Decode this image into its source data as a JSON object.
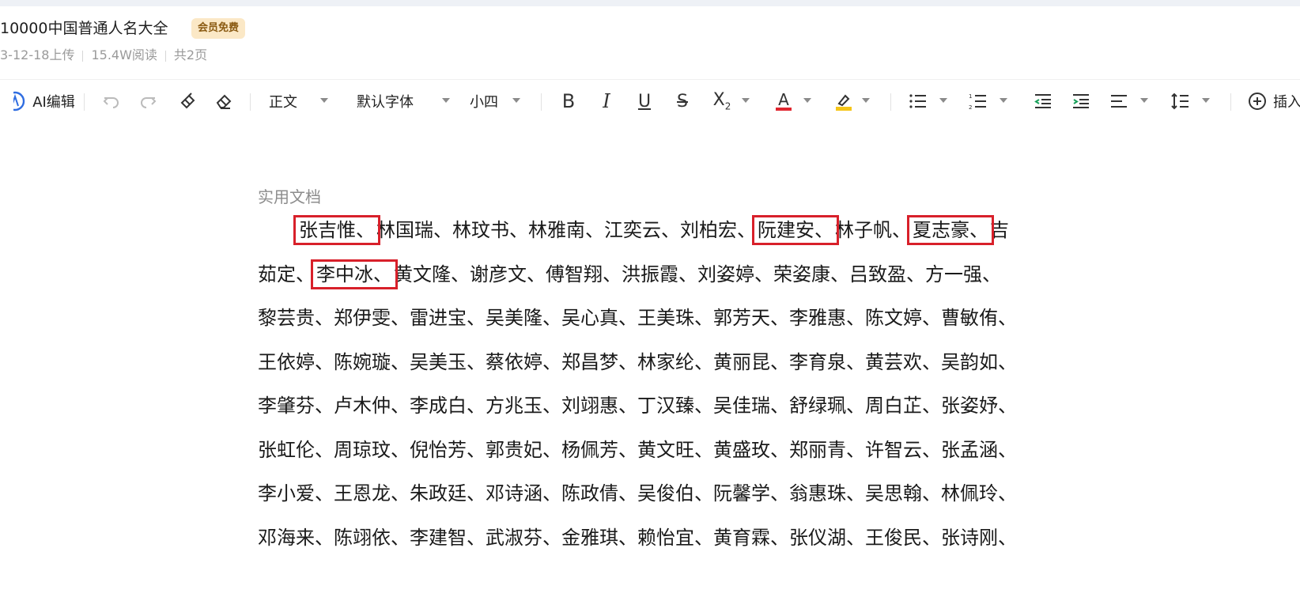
{
  "header": {
    "title": "10000中国普通人名大全",
    "badge": "会员免费",
    "upload_date": "3-12-18上传",
    "reads": "15.4W阅读",
    "pages": "共2页"
  },
  "toolbar": {
    "ai_edit_label": "AI编辑",
    "style_select": "正文",
    "font_select": "默认字体",
    "size_select": "小四",
    "insert_label": "插入"
  },
  "colors": {
    "highlight_box": "#d8202a",
    "font_color_bar": "#e0262f",
    "highlight_color_bar": "#f5c518"
  },
  "document": {
    "label": "实用文档",
    "lines": [
      {
        "segments": [
          {
            "text": "张吉惟、",
            "highlighted": true
          },
          {
            "text": "林国瑞、林玟书、林雅南、江奕云、刘柏宏、",
            "highlighted": false
          },
          {
            "text": "阮建安、",
            "highlighted": true
          },
          {
            "text": "林子帆、",
            "highlighted": false
          },
          {
            "text": "夏志豪、",
            "highlighted": true
          },
          {
            "text": "吉",
            "highlighted": false
          }
        ]
      },
      {
        "segments": [
          {
            "text": "茹定、",
            "highlighted": false
          },
          {
            "text": "李中冰、",
            "highlighted": true
          },
          {
            "text": "黄文隆、谢彦文、傅智翔、洪振霞、刘姿婷、荣姿康、吕致盈、方一强、",
            "highlighted": false
          }
        ]
      },
      {
        "text": "黎芸贵、郑伊雯、雷进宝、吴美隆、吴心真、王美珠、郭芳天、李雅惠、陈文婷、曹敏侑、"
      },
      {
        "text": "王依婷、陈婉璇、吴美玉、蔡依婷、郑昌梦、林家纶、黄丽昆、李育泉、黄芸欢、吴韵如、"
      },
      {
        "text": "李肇芬、卢木仲、李成白、方兆玉、刘翊惠、丁汉臻、吴佳瑞、舒绿珮、周白芷、张姿妤、"
      },
      {
        "text": "张虹伦、周琼玟、倪怡芳、郭贵妃、杨佩芳、黄文旺、黄盛玫、郑丽青、许智云、张孟涵、"
      },
      {
        "text": "李小爱、王恩龙、朱政廷、邓诗涵、陈政倩、吴俊伯、阮馨学、翁惠珠、吴思翰、林佩玲、"
      },
      {
        "text": "邓海来、陈翊依、李建智、武淑芬、金雅琪、赖怡宜、黄育霖、张仪湖、王俊民、张诗刚、"
      }
    ]
  }
}
